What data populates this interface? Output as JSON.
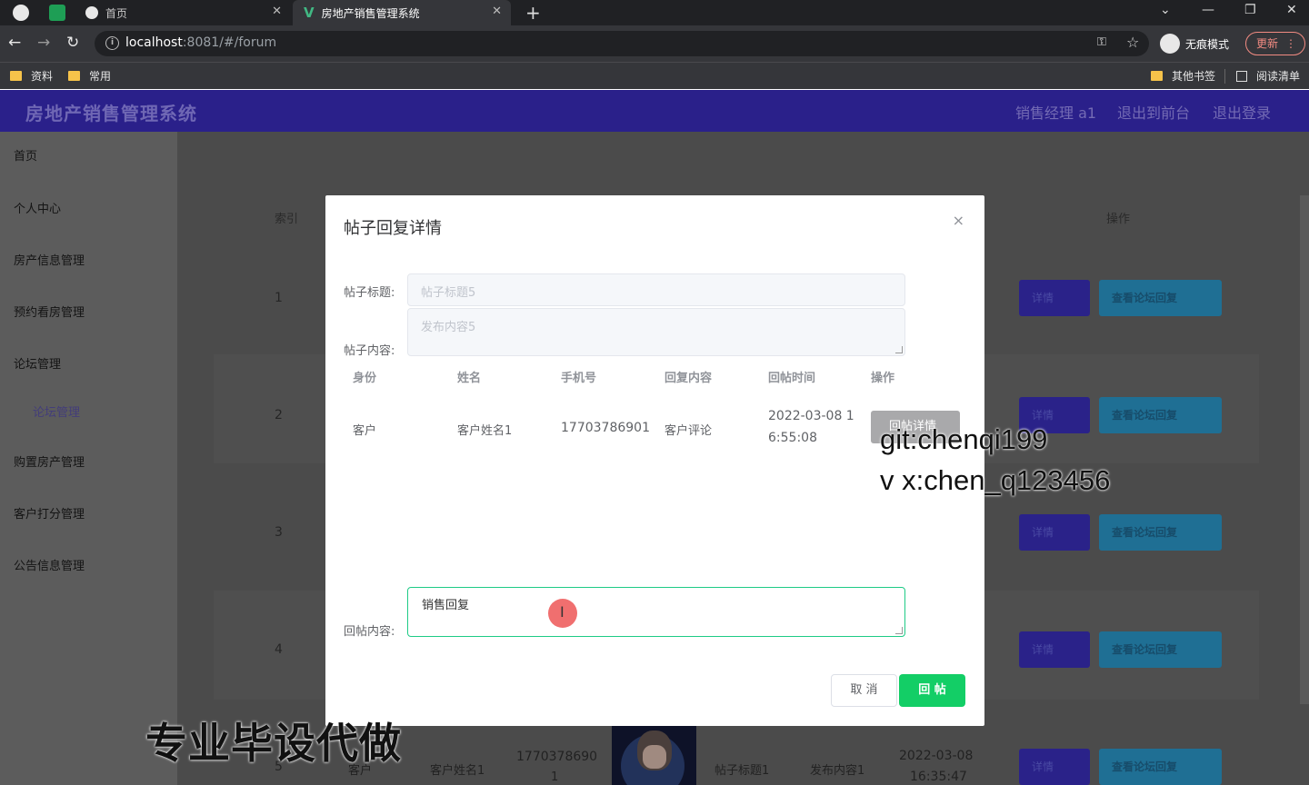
{
  "browser": {
    "tabs": [
      {
        "label": "首页"
      },
      {
        "label": "房地产销售管理系统"
      }
    ],
    "new_tab": "+",
    "url_host": "localhost",
    "url_rest": ":8081/#/forum",
    "incognito_label": "无痕模式",
    "update_label": "更新",
    "bookmarks": [
      "资料",
      "常用"
    ],
    "other_bookmarks": "其他书签",
    "reading_list": "阅读清单"
  },
  "header": {
    "title": "房地产销售管理系统",
    "user": "销售经理 a1",
    "back_front": "退出到前台",
    "logout": "退出登录"
  },
  "sidebar": {
    "items": [
      "首页",
      "个人中心",
      "房产信息管理",
      "预约看房管理",
      "论坛管理"
    ],
    "sub_item": "论坛管理",
    "items_after": [
      "购置房产管理",
      "客户打分管理",
      "公告信息管理"
    ]
  },
  "table": {
    "col_index": "索引",
    "col_action": "操作",
    "rows": [
      "1",
      "2",
      "3",
      "4",
      "5"
    ],
    "btn_detail": "详情",
    "btn_view_reply": "查看论坛回复",
    "row5": {
      "identity": "客户",
      "name": "客户姓名1",
      "phone_a": "1770378690",
      "phone_b": "1",
      "title": "帖子标题1",
      "content": "发布内容1",
      "time_a": "2022-03-08",
      "time_b": "16:35:47"
    }
  },
  "dialog": {
    "title": "帖子回复详情",
    "close": "×",
    "label_title": "帖子标题:",
    "value_title": "帖子标题5",
    "label_content": "帖子内容:",
    "value_content": "发布内容5",
    "reply_headers": [
      "身份",
      "姓名",
      "手机号",
      "回复内容",
      "回帖时间",
      "操作"
    ],
    "reply_row": {
      "identity": "客户",
      "name": "客户姓名1",
      "phone": "17703786901",
      "content": "客户评论",
      "time_a": "2022-03-08 1",
      "time_b": "6:55:08",
      "action": "回帖详情"
    },
    "label_reply": "回帖内容:",
    "reply_value": "销售回复",
    "btn_cancel": "取 消",
    "btn_submit": "回 帖"
  },
  "overlays": {
    "watermark_1": "git:chenqi199",
    "watermark_2": "v x:chen_q123456",
    "banner": "专业毕设代做"
  }
}
